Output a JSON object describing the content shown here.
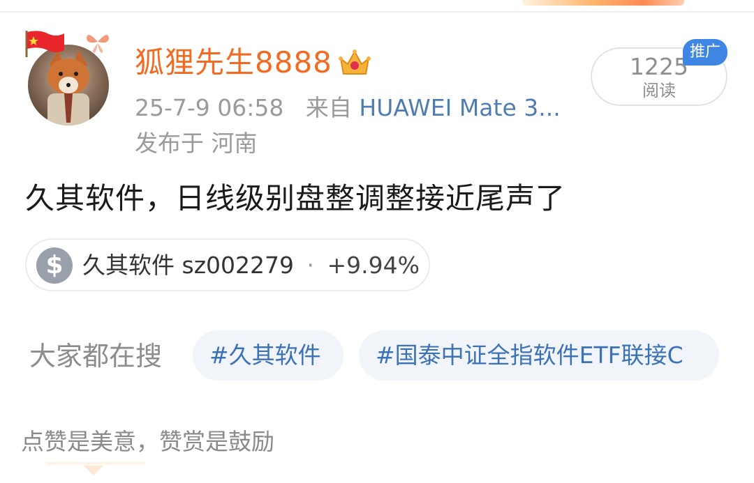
{
  "post": {
    "username": "狐狸先生8888",
    "timestamp": "25-7-9 06:58",
    "source_prefix": "来自",
    "device": "HUAWEI Mate 3...",
    "location": "发布于 河南",
    "read_count": "1225",
    "read_label": "阅读",
    "promo_badge": "推广",
    "text": "久其软件，日线级别盘整调整接近尾声了"
  },
  "stock": {
    "icon": "dollar-icon",
    "name": "久其软件",
    "code": "sz002279",
    "separator": "·",
    "change": "+9.94%"
  },
  "hot_search": {
    "label": "大家都在搜",
    "topics": [
      "#久其软件",
      "#国泰中证全指软件ETF联接C"
    ]
  },
  "reward": {
    "text": "点赞是美意，赞赏是鼓励"
  },
  "colors": {
    "username": "#f36b22",
    "device_link": "#507daf",
    "topic_text": "#3b72b6",
    "promo_badge": "#3f86e4"
  }
}
